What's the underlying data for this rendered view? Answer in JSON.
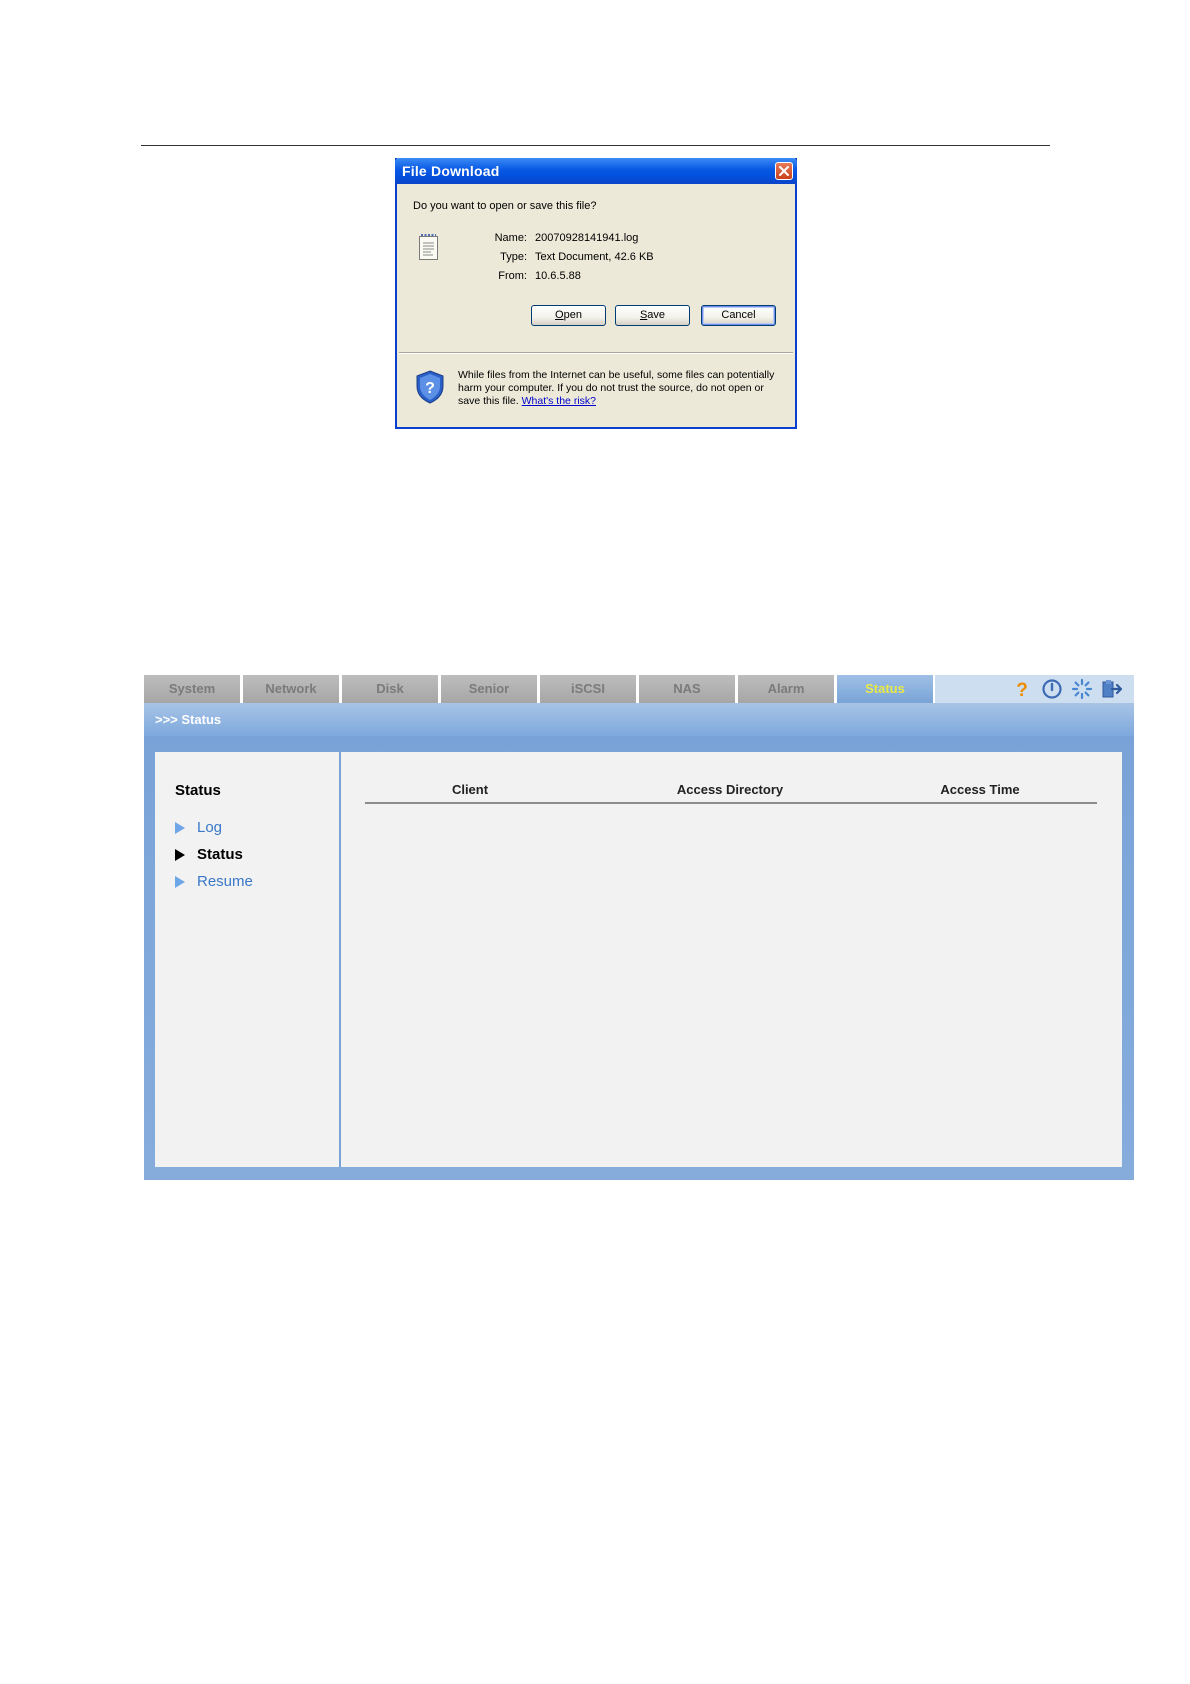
{
  "dialog": {
    "title": "File Download",
    "question": "Do you want to open or save this file?",
    "file": {
      "name_label": "Name:",
      "name_value": "20070928141941.log",
      "type_label": "Type:",
      "type_value": "Text Document, 42.6 KB",
      "from_label": "From:",
      "from_value": "10.6.5.88"
    },
    "buttons": {
      "open_access_key": "O",
      "open_rest": "pen",
      "save_access_key": "S",
      "save_rest": "ave",
      "cancel": "Cancel"
    },
    "warning": {
      "text": "While files from the Internet can be useful, some files can potentially harm your computer. If you do not trust the source, do not open or save this file.",
      "link": "What's the risk?"
    },
    "icons": [
      "close-icon",
      "text-file-icon",
      "security-shield-icon"
    ]
  },
  "webui": {
    "tabs": [
      {
        "label": "System"
      },
      {
        "label": "Network"
      },
      {
        "label": "Disk"
      },
      {
        "label": "Senior"
      },
      {
        "label": "iSCSI"
      },
      {
        "label": "NAS"
      },
      {
        "label": "Alarm"
      },
      {
        "label": "Status",
        "active": true
      }
    ],
    "toolbar_icons": [
      "help-icon",
      "power-icon",
      "restart-icon",
      "logout-icon"
    ],
    "breadcrumb": ">>> Status",
    "sidebar": {
      "heading": "Status",
      "items": [
        {
          "label": "Log",
          "current": false
        },
        {
          "label": "Status",
          "current": true
        },
        {
          "label": "Resume",
          "current": false
        }
      ]
    },
    "table": {
      "columns": [
        "Client",
        "Access Directory",
        "Access Time"
      ],
      "rows": []
    },
    "colors": {
      "active_tab_text": "#e8e84a",
      "inactive_tab_bg": "#a6a6a6",
      "frame_blue": "#7ea8dd",
      "link_blue": "#3a78c8"
    }
  }
}
